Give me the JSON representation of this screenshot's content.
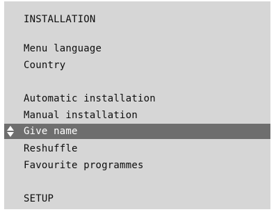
{
  "menu": {
    "title": "INSTALLATION",
    "items": [
      "Menu language",
      "Country",
      "Automatic installation",
      "Manual installation",
      "Give name",
      "Reshuffle",
      "Favourite programmes"
    ],
    "selected_item": "Give name",
    "footer": "SETUP"
  },
  "icons": {
    "selection": "up-down-arrow-icon"
  },
  "colors": {
    "panel": "#d6d6d6",
    "highlight": "#6e6e6e",
    "text": "#0d0d0d",
    "highlight_text": "#ffffff"
  }
}
